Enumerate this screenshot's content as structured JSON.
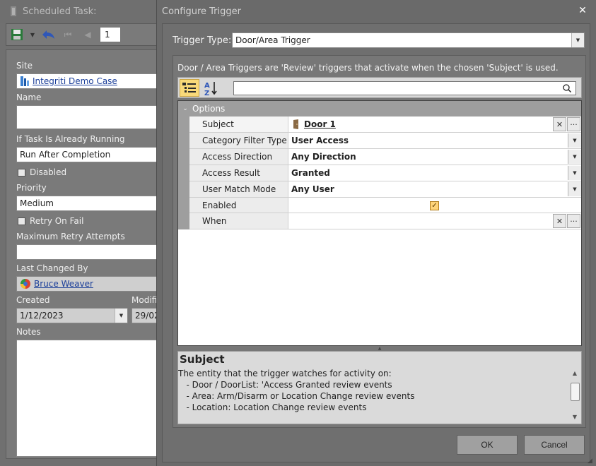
{
  "background_window": {
    "title": "Scheduled Task:",
    "page_value": "1",
    "form": {
      "site_label": "Site",
      "site_value": "Integriti Demo Case",
      "name_label": "Name",
      "name_value": "",
      "running_label": "If Task Is Already Running",
      "running_value": "Run After Completion",
      "disabled_label": "Disabled",
      "priority_label": "Priority",
      "priority_value": "Medium",
      "retry_label": "Retry On Fail",
      "max_retry_label": "Maximum Retry Attempts",
      "max_retry_value": "",
      "last_changed_label": "Last Changed By",
      "last_changed_value": "Bruce Weaver",
      "created_label": "Created",
      "created_value": "1/12/2023",
      "modified_label": "Modifi",
      "modified_value": "29/02",
      "notes_label": "Notes"
    }
  },
  "dialog": {
    "title": "Configure Trigger",
    "trigger_type_label": "Trigger Type:",
    "trigger_type_value": "Door/Area Trigger",
    "description": "Door / Area Triggers are 'Review' triggers that activate when the chosen 'Subject' is used.",
    "search_placeholder": "",
    "category": "Options",
    "rows": [
      {
        "name": "Subject",
        "value": "Door 1"
      },
      {
        "name": "Category Filter Type",
        "value": "User Access"
      },
      {
        "name": "Access Direction",
        "value": "Any Direction"
      },
      {
        "name": "Access Result",
        "value": "Granted"
      },
      {
        "name": "User Match Mode",
        "value": "Any User"
      },
      {
        "name": "Enabled",
        "value": ""
      },
      {
        "name": "When",
        "value": ""
      }
    ],
    "enabled_checked": true,
    "help": {
      "title": "Subject",
      "lines": [
        "The entity that the trigger watches for activity on:",
        "   - Door / DoorList: 'Access Granted review events",
        "   - Area: Arm/Disarm or Location Change review events",
        "   - Location: Location Change review events"
      ]
    },
    "ok_label": "OK",
    "cancel_label": "Cancel"
  },
  "icons": [
    "door-icon",
    "search-icon",
    "categorized-icon",
    "sort-alpha-icon",
    "close-icon",
    "save-icon",
    "undo-icon",
    "site-icon",
    "user-icon",
    "clear-icon",
    "ellipsis-icon",
    "dropdown-icon"
  ]
}
